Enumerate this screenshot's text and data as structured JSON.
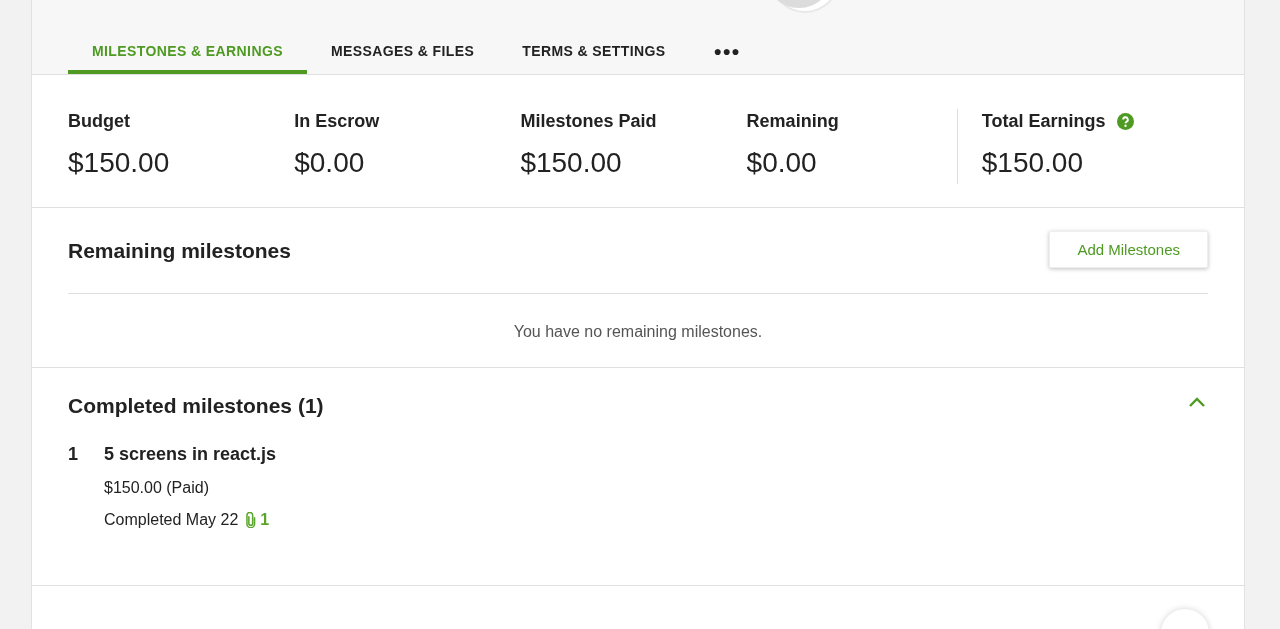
{
  "tabs": [
    {
      "label": "MILESTONES & EARNINGS",
      "selected": true
    },
    {
      "label": "MESSAGES & FILES",
      "selected": false
    },
    {
      "label": "TERMS & SETTINGS",
      "selected": false
    },
    {
      "label": "●●●",
      "selected": false
    }
  ],
  "stats": [
    {
      "label": "Budget",
      "value": "$150.00"
    },
    {
      "label": "In Escrow",
      "value": "$0.00"
    },
    {
      "label": "Milestones Paid",
      "value": "$150.00"
    },
    {
      "label": "Remaining",
      "value": "$0.00"
    }
  ],
  "total": {
    "label": "Total Earnings",
    "value": "$150.00",
    "help": true
  },
  "remaining": {
    "title": "Remaining milestones",
    "button": "Add Milestones",
    "empty": "You have no remaining milestones."
  },
  "completed": {
    "title": "Completed milestones (1)",
    "expanded": true,
    "items": [
      {
        "number": "1",
        "title": "5 screens in react.js",
        "amount": "$150.00 (Paid)",
        "date": "Completed May 22",
        "attachments": "1"
      }
    ]
  }
}
